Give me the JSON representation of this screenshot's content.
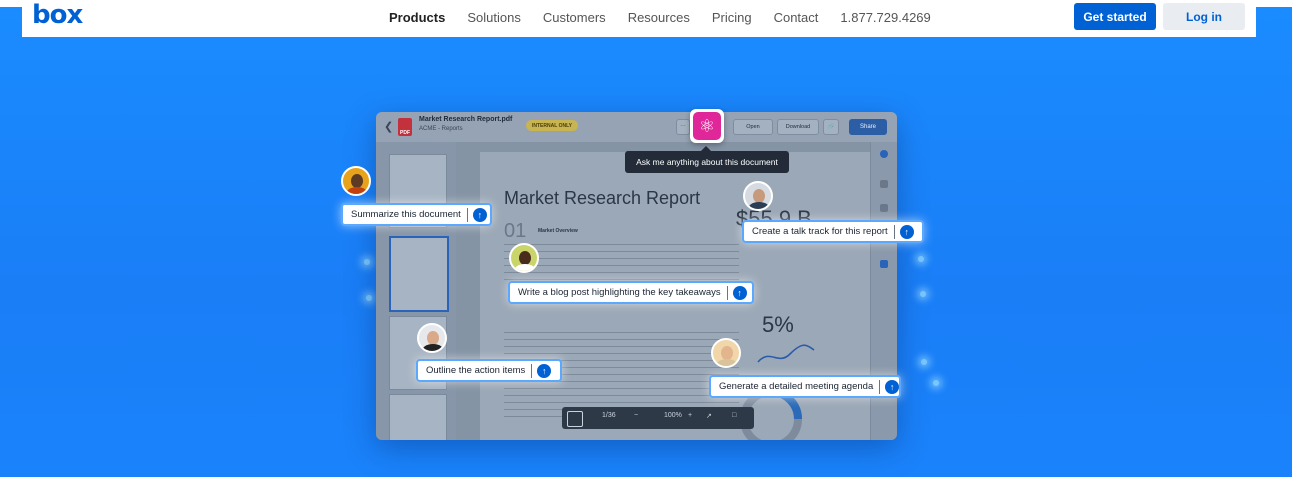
{
  "nav": {
    "logo": "box",
    "links": [
      "Products",
      "Solutions",
      "Customers",
      "Resources",
      "Pricing",
      "Contact",
      "1.877.729.4269"
    ],
    "cta_primary": "Get started",
    "cta_secondary": "Log in"
  },
  "app": {
    "file_name": "Market Research Report.pdf",
    "folder": "ACME - Reports",
    "badge": "INTERNAL ONLY",
    "open_label": "Open",
    "download_label": "Download",
    "share_label": "Share",
    "doc_title": "Market Research Report",
    "section_num": "01",
    "section_title": "Market Overview",
    "stat_big": "$55.9 B",
    "stat_pct": "5%",
    "donut_pct": "20%",
    "page_indicator": "1/36",
    "zoom": "100%"
  },
  "ai": {
    "icon": "atom-icon",
    "tooltip": "Ask me anything about this document"
  },
  "prompts": [
    {
      "text": "Summarize this document"
    },
    {
      "text": "Create a talk track for this report"
    },
    {
      "text": "Write a blog post highlighting the key takeaways"
    },
    {
      "text": "Outline the action items"
    },
    {
      "text": "Generate a detailed meeting agenda"
    }
  ],
  "colors": {
    "hero": "#1a8cff",
    "brand": "#0061d5",
    "ai_magenta": "#e0279a"
  }
}
